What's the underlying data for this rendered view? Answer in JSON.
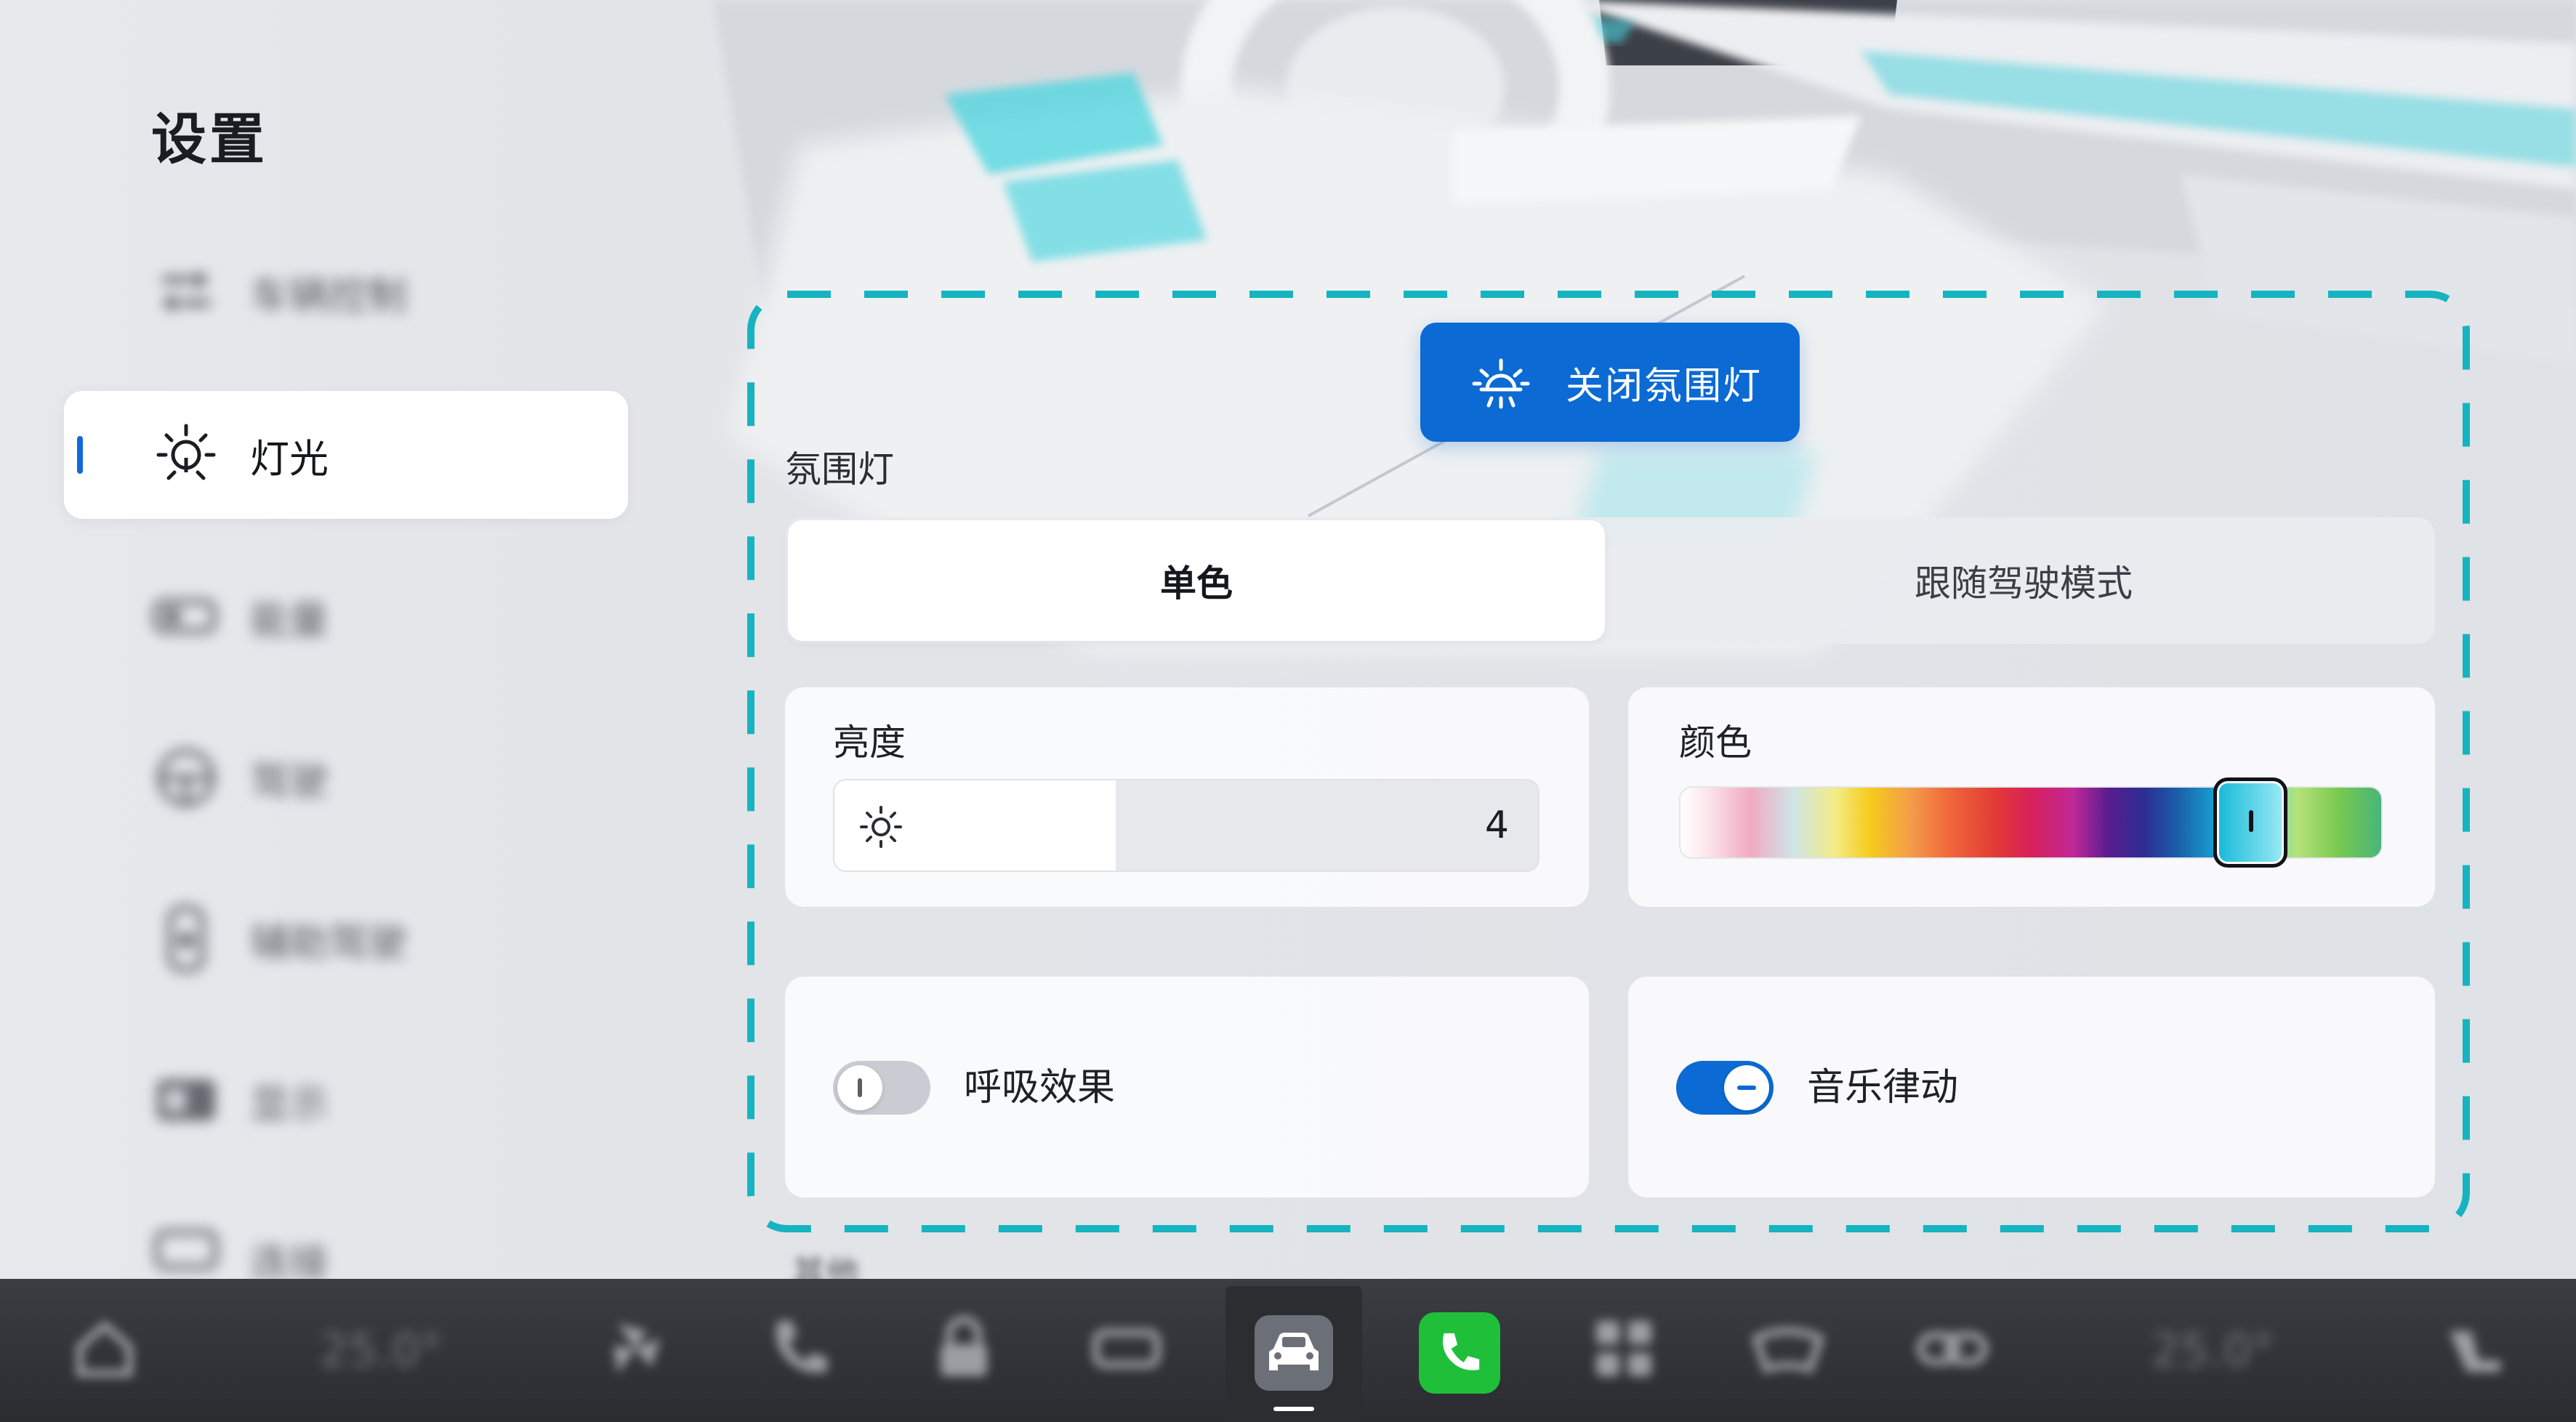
{
  "page": {
    "title": "设置"
  },
  "sidebar": {
    "items": [
      {
        "label": "车辆控制",
        "icon": "vehicle-control-icon",
        "active": false
      },
      {
        "label": "灯光",
        "icon": "light-bulb-icon",
        "active": true
      },
      {
        "label": "能量",
        "icon": "battery-icon",
        "active": false
      },
      {
        "label": "驾驶",
        "icon": "steering-wheel-icon",
        "active": false
      },
      {
        "label": "辅助驾驶",
        "icon": "assist-driving-icon",
        "active": false
      },
      {
        "label": "显示",
        "icon": "display-icon",
        "active": false
      },
      {
        "label": "连接",
        "icon": "connection-icon",
        "active": false
      }
    ]
  },
  "ambient": {
    "off_button_label": "关闭氛围灯",
    "off_button_icon": "ambient-light-icon",
    "section_title": "氛围灯",
    "modes": [
      {
        "label": "单色",
        "selected": true
      },
      {
        "label": "跟随驾驶模式",
        "selected": false
      }
    ],
    "brightness": {
      "label": "亮度",
      "value": "4",
      "level": 0.4,
      "icon": "sun-icon"
    },
    "color": {
      "label": "颜色",
      "selected_position": 0.81,
      "selected_hex": "#2bc6e2"
    },
    "breathing": {
      "label": "呼吸效果",
      "enabled": false
    },
    "music_rhythm": {
      "label": "音乐律动",
      "enabled": true
    },
    "next_section_peek": "其他"
  },
  "dock": {
    "items": [
      "home-icon",
      "fan-icon",
      "phone-icon",
      "lock-icon",
      "battery-icon",
      "car-icon",
      "phone-app-icon",
      "apps-grid-icon",
      "defrost-icon",
      "link-icon",
      "seat-heat-icon"
    ],
    "left_temp": "25.0°",
    "right_temp": "25.0°",
    "active": "car-icon"
  },
  "colors": {
    "accent": "#0b6ad4",
    "dashed_frame": "#15b4c0",
    "phone_green": "#1fbf3a"
  }
}
